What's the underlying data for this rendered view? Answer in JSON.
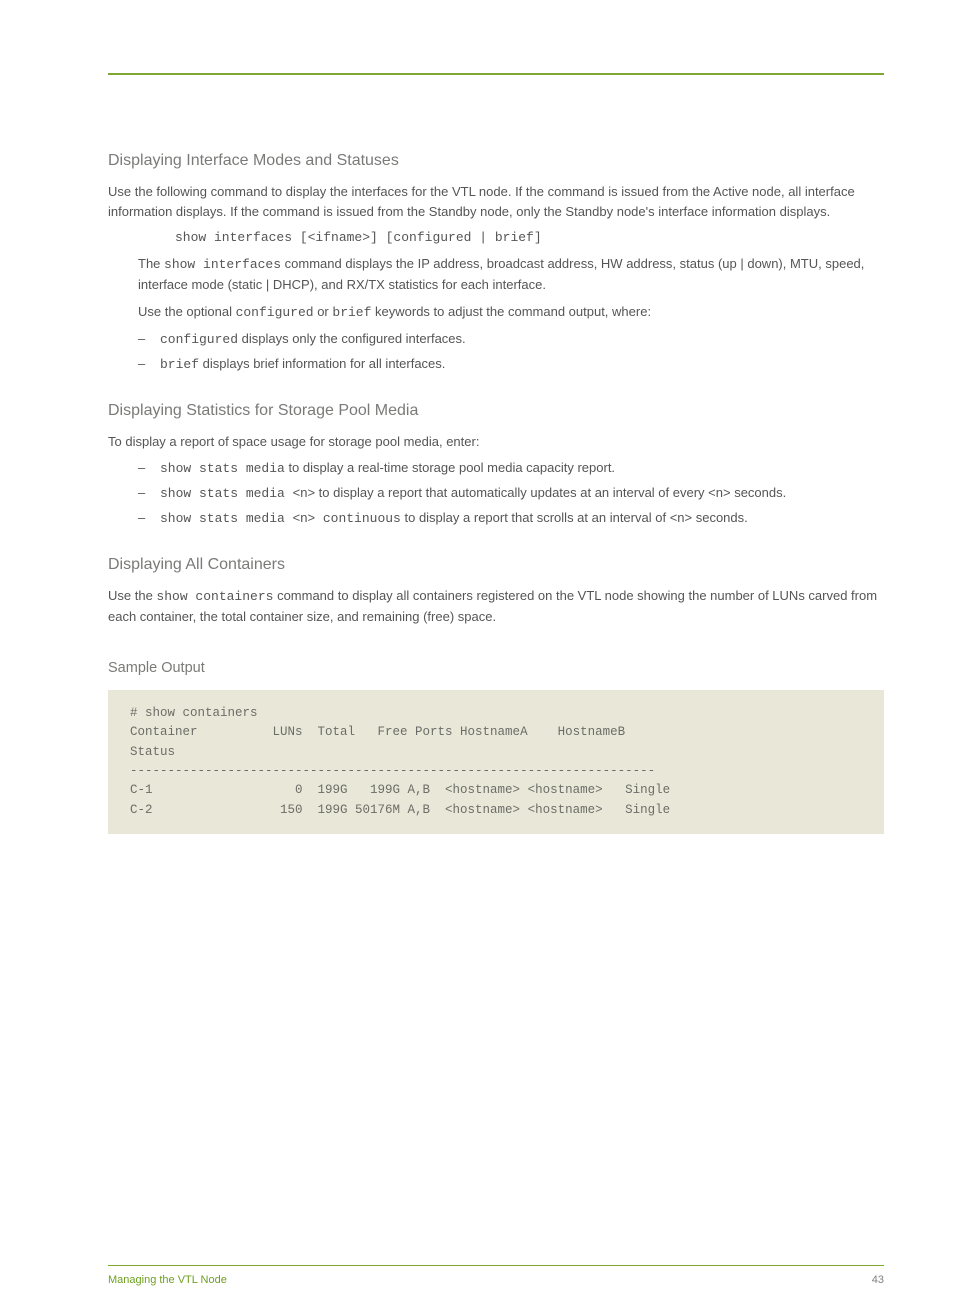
{
  "sections": {
    "s1": {
      "heading": "Displaying Interface Modes and Statuses",
      "p1a": "Use the following command to display the interfaces for the VTL node. If the command is issued from the Active node, all interface information displays. If the command is issued from the Standby node, only the Standby node's interface information displays.",
      "cmd": "show interfaces [<ifname>] [configured | brief]",
      "p2a": "The ",
      "p2b": "show interfaces",
      "p2c": " command displays the IP address, broadcast address, HW address, status (up | down), MTU, speed, interface mode (static | DHCP), and RX/TX statistics for each interface.",
      "p3a": "Use the optional ",
      "p3b": "configured",
      "p3c": " or ",
      "p3d": "brief",
      "p3e": " keywords to adjust the command output, where:",
      "bullet1a": "configured",
      "bullet1b": " displays only the configured interfaces.",
      "bullet2a": "brief",
      "bullet2b": " displays brief information for all interfaces."
    },
    "s2": {
      "heading": "Displaying Statistics for Storage Pool Media",
      "p1": "To display a report of space usage for storage pool media, enter:",
      "bullet1a": "show stats media",
      "bullet1b": " to display a real-time storage pool media capacity report.",
      "bullet2a": "show stats media ",
      "bullet2b": "<n>",
      "bullet2c": " to display a report that automatically updates at an interval of every ",
      "bullet2d": "<n>",
      "bullet2e": " seconds.",
      "bullet3a": "show stats media ",
      "bullet3b": "<n>",
      "bullet3c": " continuous",
      "bullet3d": " to display a report that scrolls at an interval of ",
      "bullet3e": "<n>",
      "bullet3f": " seconds."
    },
    "s3": {
      "heading": "Displaying All Containers",
      "p1a": "Use the ",
      "p1b": "show containers",
      "p1c": " command to display all containers registered on the VTL node showing the number of LUNs carved from each container, the total container size, and remaining (free) space.",
      "sub": "Sample Output",
      "code": "# show containers\nContainer          LUNs  Total   Free Ports HostnameA    HostnameB   \nStatus\n----------------------------------------------------------------------\nC-1                   0  199G   199G A,B  <hostname> <hostname>   Single\nC-2                 150  199G 50176M A,B  <hostname> <hostname>   Single"
    },
    "footer": {
      "left": "Managing the VTL Node",
      "right": "43"
    }
  }
}
